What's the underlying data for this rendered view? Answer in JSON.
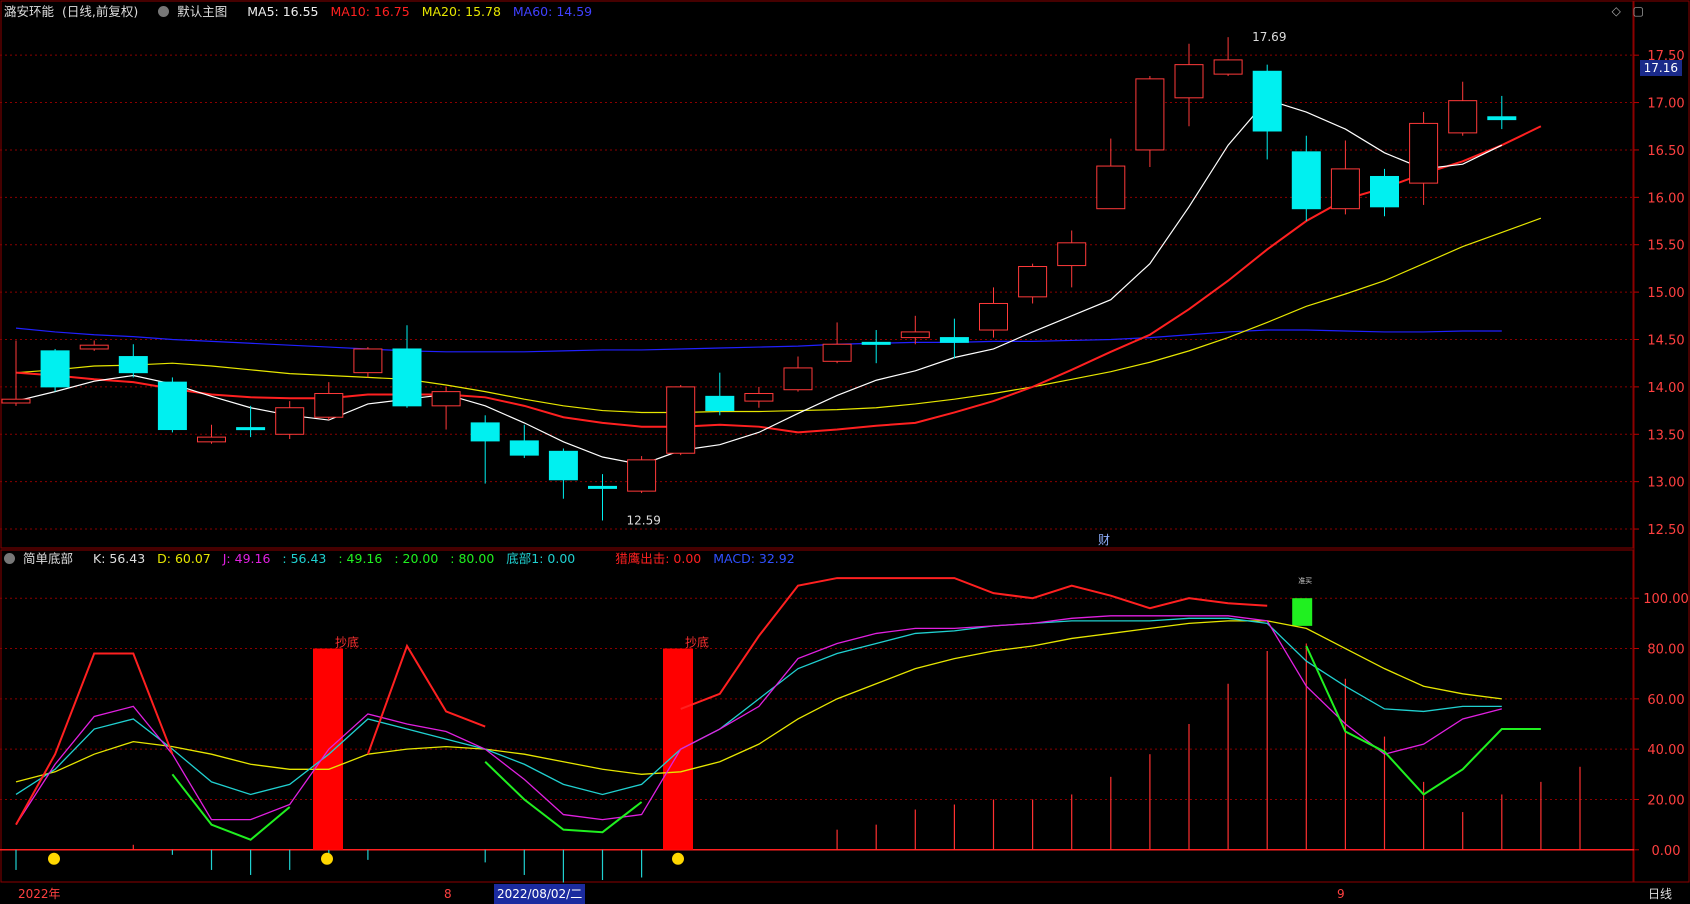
{
  "main_header": {
    "stock_name": "潞安环能",
    "period": "(日线,前复权)",
    "template": "默认主图",
    "ma5": "MA5: 16.55",
    "ma10": "MA10: 16.75",
    "ma20": "MA20: 15.78",
    "ma60": "MA60: 14.59"
  },
  "sub_header": {
    "indicator": "简单底部",
    "k": "K: 56.43",
    "d": "D: 60.07",
    "j": "J: 49.16",
    "v1": ": 56.43",
    "v2": ": 49.16",
    "v3": ": 20.00",
    "v4": ": 80.00",
    "bottom1": "底部1: 0.00",
    "eagle": "猎鹰出击: 0.00",
    "macd": "MACD: 32.92"
  },
  "price_tag": "17.16",
  "annotations": {
    "high": "17.69",
    "low": "12.59",
    "fin": "财",
    "chaodi1": "抄底",
    "chaodi2": "抄底",
    "small": "准买"
  },
  "bottom_bar": {
    "year": "2022年",
    "m8": "8",
    "selected_date": "2022/08/02/二",
    "m9": "9",
    "period_label": "日线"
  },
  "colors": {
    "up": "#ff3a3a",
    "down": "#00f0f0",
    "ma5": "#ffffff",
    "ma10": "#ff2020",
    "ma20": "#e6e600",
    "ma60": "#2020ff",
    "k": "#20d0d0",
    "d": "#e6e600",
    "j": "#e020e0",
    "green": "#20f020"
  },
  "chart_data": {
    "type": "candlestick",
    "price_axis": [
      12.5,
      13.0,
      13.5,
      14.0,
      14.5,
      15.0,
      15.5,
      16.0,
      16.5,
      17.0,
      17.5
    ],
    "price_ylim": [
      12.3,
      17.85
    ],
    "candles": [
      {
        "o": 13.83,
        "c": 13.87,
        "h": 14.49,
        "l": 13.8
      },
      {
        "o": 14.38,
        "c": 14.0,
        "h": 14.4,
        "l": 13.95
      },
      {
        "o": 14.4,
        "c": 14.44,
        "h": 14.49,
        "l": 14.38
      },
      {
        "o": 14.32,
        "c": 14.15,
        "h": 14.45,
        "l": 14.1
      },
      {
        "o": 14.05,
        "c": 13.55,
        "h": 14.1,
        "l": 13.52
      },
      {
        "o": 13.42,
        "c": 13.47,
        "h": 13.6,
        "l": 13.4
      },
      {
        "o": 13.57,
        "c": 13.57,
        "h": 13.8,
        "l": 13.47
      },
      {
        "o": 13.5,
        "c": 13.78,
        "h": 13.85,
        "l": 13.45
      },
      {
        "o": 13.68,
        "c": 13.93,
        "h": 14.05,
        "l": 13.65
      },
      {
        "o": 14.15,
        "c": 14.4,
        "h": 14.42,
        "l": 14.1
      },
      {
        "o": 14.4,
        "c": 13.8,
        "h": 14.65,
        "l": 13.78
      },
      {
        "o": 13.8,
        "c": 13.95,
        "h": 14.0,
        "l": 13.55
      },
      {
        "o": 13.62,
        "c": 13.43,
        "h": 13.7,
        "l": 12.98
      },
      {
        "o": 13.43,
        "c": 13.28,
        "h": 13.6,
        "l": 13.25
      },
      {
        "o": 13.32,
        "c": 13.02,
        "h": 13.35,
        "l": 12.82
      },
      {
        "o": 12.95,
        "c": 12.95,
        "h": 13.08,
        "l": 12.59
      },
      {
        "o": 12.9,
        "c": 13.23,
        "h": 13.27,
        "l": 12.88
      },
      {
        "o": 13.3,
        "c": 14.0,
        "h": 14.02,
        "l": 13.28
      },
      {
        "o": 13.9,
        "c": 13.75,
        "h": 14.15,
        "l": 13.7
      },
      {
        "o": 13.85,
        "c": 13.93,
        "h": 14.0,
        "l": 13.78
      },
      {
        "o": 13.97,
        "c": 14.2,
        "h": 14.32,
        "l": 13.95
      },
      {
        "o": 14.27,
        "c": 14.45,
        "h": 14.68,
        "l": 14.25
      },
      {
        "o": 14.47,
        "c": 14.47,
        "h": 14.6,
        "l": 14.25
      },
      {
        "o": 14.52,
        "c": 14.58,
        "h": 14.75,
        "l": 14.45
      },
      {
        "o": 14.52,
        "c": 14.47,
        "h": 14.72,
        "l": 14.3
      },
      {
        "o": 14.6,
        "c": 14.88,
        "h": 15.05,
        "l": 14.52
      },
      {
        "o": 14.95,
        "c": 15.27,
        "h": 15.3,
        "l": 14.88
      },
      {
        "o": 15.28,
        "c": 15.52,
        "h": 15.65,
        "l": 15.05
      },
      {
        "o": 15.88,
        "c": 16.33,
        "h": 16.62,
        "l": 15.88
      },
      {
        "o": 16.5,
        "c": 17.25,
        "h": 17.28,
        "l": 16.32
      },
      {
        "o": 17.05,
        "c": 17.4,
        "h": 17.62,
        "l": 16.75
      },
      {
        "o": 17.3,
        "c": 17.45,
        "h": 17.69,
        "l": 17.28
      },
      {
        "o": 17.33,
        "c": 16.7,
        "h": 17.4,
        "l": 16.4
      },
      {
        "o": 16.48,
        "c": 15.88,
        "h": 16.65,
        "l": 15.75
      },
      {
        "o": 15.88,
        "c": 16.3,
        "h": 16.6,
        "l": 15.82
      },
      {
        "o": 16.22,
        "c": 15.9,
        "h": 16.3,
        "l": 15.8
      },
      {
        "o": 16.15,
        "c": 16.78,
        "h": 16.9,
        "l": 15.92
      },
      {
        "o": 16.68,
        "c": 17.02,
        "h": 17.22,
        "l": 16.65
      },
      {
        "o": 16.85,
        "c": 16.82,
        "h": 17.07,
        "l": 16.72
      }
    ],
    "ma5": [
      13.85,
      13.95,
      14.06,
      14.12,
      14.03,
      13.9,
      13.78,
      13.7,
      13.65,
      13.82,
      13.87,
      13.92,
      13.8,
      13.62,
      13.42,
      13.26,
      13.18,
      13.33,
      13.39,
      13.52,
      13.72,
      13.91,
      14.07,
      14.17,
      14.31,
      14.4,
      14.58,
      14.75,
      14.92,
      15.3,
      15.9,
      16.55,
      17.03,
      16.9,
      16.72,
      16.47,
      16.3,
      16.35,
      16.55
    ],
    "ma10": [
      14.15,
      14.12,
      14.08,
      14.05,
      13.98,
      13.92,
      13.89,
      13.88,
      13.88,
      13.92,
      13.92,
      13.92,
      13.89,
      13.8,
      13.68,
      13.62,
      13.58,
      13.58,
      13.6,
      13.58,
      13.52,
      13.55,
      13.59,
      13.62,
      13.73,
      13.85,
      14.0,
      14.18,
      14.37,
      14.55,
      14.82,
      15.12,
      15.45,
      15.75,
      15.98,
      16.1,
      16.25,
      16.38,
      16.55,
      16.75
    ],
    "ma20": [
      14.15,
      14.18,
      14.22,
      14.23,
      14.25,
      14.22,
      14.18,
      14.14,
      14.12,
      14.1,
      14.08,
      14.02,
      13.95,
      13.87,
      13.8,
      13.75,
      13.73,
      13.73,
      13.74,
      13.74,
      13.75,
      13.76,
      13.78,
      13.82,
      13.87,
      13.93,
      14.0,
      14.08,
      14.16,
      14.26,
      14.38,
      14.52,
      14.68,
      14.85,
      14.98,
      15.12,
      15.3,
      15.48,
      15.63,
      15.78
    ],
    "ma60": [
      14.62,
      14.58,
      14.55,
      14.53,
      14.5,
      14.48,
      14.46,
      14.44,
      14.42,
      14.4,
      14.38,
      14.37,
      14.37,
      14.37,
      14.38,
      14.39,
      14.39,
      14.4,
      14.41,
      14.42,
      14.43,
      14.45,
      14.46,
      14.47,
      14.47,
      14.48,
      14.48,
      14.49,
      14.5,
      14.52,
      14.55,
      14.58,
      14.6,
      14.6,
      14.59,
      14.58,
      14.58,
      14.59,
      14.59
    ],
    "indicator_axis": [
      0.0,
      20.0,
      40.0,
      60.0,
      80.0,
      100.0
    ],
    "indicator_ylim": [
      -12,
      112
    ],
    "k": [
      22,
      32,
      48,
      52,
      40,
      27,
      22,
      26,
      38,
      52,
      48,
      44,
      40,
      34,
      26,
      22,
      26,
      40,
      48,
      60,
      72,
      78,
      82,
      86,
      87,
      89,
      90,
      91,
      91,
      91,
      92,
      92,
      90,
      75,
      65,
      56,
      55,
      57,
      57
    ],
    "d": [
      27,
      31,
      38,
      43,
      41,
      38,
      34,
      32,
      32,
      38,
      40,
      41,
      40,
      38,
      35,
      32,
      30,
      31,
      35,
      42,
      52,
      60,
      66,
      72,
      76,
      79,
      81,
      84,
      86,
      88,
      90,
      91,
      91,
      88,
      80,
      72,
      65,
      62,
      60
    ],
    "j": [
      10,
      34,
      53,
      57,
      38,
      12,
      12,
      18,
      40,
      54,
      50,
      47,
      40,
      28,
      14,
      12,
      14,
      40,
      48,
      57,
      76,
      82,
      86,
      88,
      88,
      89,
      90,
      92,
      93,
      93,
      93,
      93,
      91,
      65,
      50,
      38,
      42,
      52,
      56
    ],
    "green": [
      null,
      null,
      null,
      null,
      30,
      10,
      4,
      17,
      null,
      null,
      null,
      null,
      35,
      20,
      8,
      7,
      19,
      null,
      null,
      null,
      null,
      null,
      null,
      null,
      null,
      null,
      null,
      null,
      null,
      null,
      null,
      null,
      null,
      81,
      47,
      39,
      22,
      32,
      48,
      48
    ],
    "red": [
      10,
      38,
      78,
      78,
      38,
      null,
      null,
      null,
      null,
      38,
      81,
      55,
      49,
      null,
      null,
      null,
      null,
      56,
      62,
      85,
      105,
      108,
      108,
      108,
      108,
      102,
      100,
      105,
      101,
      96,
      100,
      98,
      97,
      null,
      null,
      null,
      null,
      null,
      null
    ],
    "macd": [
      -8,
      null,
      null,
      2,
      -2,
      -8,
      -10,
      -8,
      -5,
      -4,
      null,
      null,
      -5,
      -10,
      -13,
      -12,
      -11,
      null,
      null,
      null,
      null,
      8,
      10,
      16,
      18,
      20,
      20,
      22,
      29,
      38,
      50,
      66,
      79,
      82,
      68,
      45,
      27,
      15,
      22,
      27,
      33
    ],
    "chaodi_bars": [
      8,
      17
    ],
    "green_bar_index": 32
  }
}
